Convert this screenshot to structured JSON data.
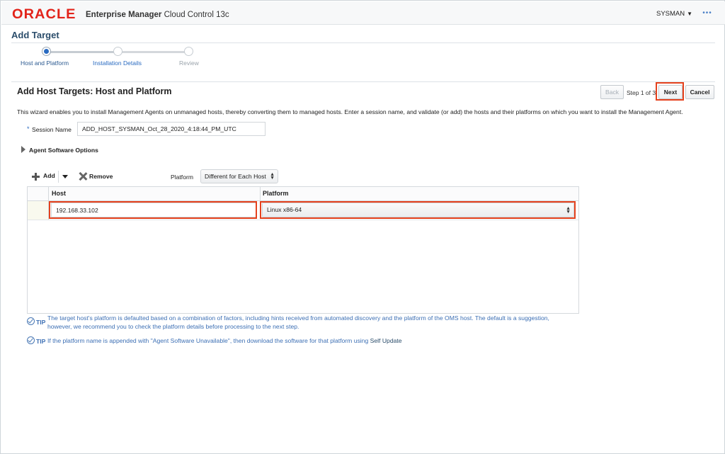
{
  "header": {
    "logo": "ORACLE",
    "product_bold": "Enterprise Manager",
    "product_rest": " Cloud Control 13c",
    "user": "SYSMAN",
    "user_caret": "▼",
    "more": "•••"
  },
  "page": {
    "title": "Add Target"
  },
  "train": {
    "steps": [
      {
        "label": "Host and Platform",
        "state": "current"
      },
      {
        "label": "Installation Details",
        "state": "link"
      },
      {
        "label": "Review",
        "state": "disabled"
      }
    ]
  },
  "section": {
    "title": "Add Host Targets: Host and Platform",
    "back_label": "Back",
    "step_text": "Step 1 of 3",
    "next_label": "Next",
    "cancel_label": "Cancel"
  },
  "intro": "This wizard enables you to install Management Agents on unmanaged hosts, thereby converting them to managed hosts. Enter a session name, and validate (or add) the hosts and their platforms on which you want to install the Management Agent.",
  "session": {
    "required_mark": "*",
    "label": "Session Name",
    "value": "ADD_HOST_SYSMAN_Oct_28_2020_4:18:44_PM_UTC"
  },
  "agent_options": {
    "label": "Agent Software Options"
  },
  "toolbar": {
    "add_label": "Add",
    "remove_label": "Remove",
    "platform_label": "Platform",
    "platform_value": "Different for Each Host"
  },
  "table": {
    "columns": [
      "Host",
      "Platform"
    ],
    "rows": [
      {
        "host": "192.168.33.102",
        "platform": "Linux x86-64"
      }
    ]
  },
  "tips": {
    "tip_label": "TIP",
    "tip1_line1": "The target host's platform is defaulted based on a combination of factors, including hints received from automated discovery and the platform of the OMS host. The default is a suggestion,",
    "tip1_line2": "however, we recommend you to check the platform details before processing to the next step.",
    "tip2_text": "If the platform name is appended with \"Agent Software Unavailable\", then download the software for that platform using",
    "tip2_link": "Self Update"
  },
  "colors": {
    "brand_red": "#e2231a",
    "link_blue": "#2a6bc1",
    "highlight": "#e5421e"
  }
}
